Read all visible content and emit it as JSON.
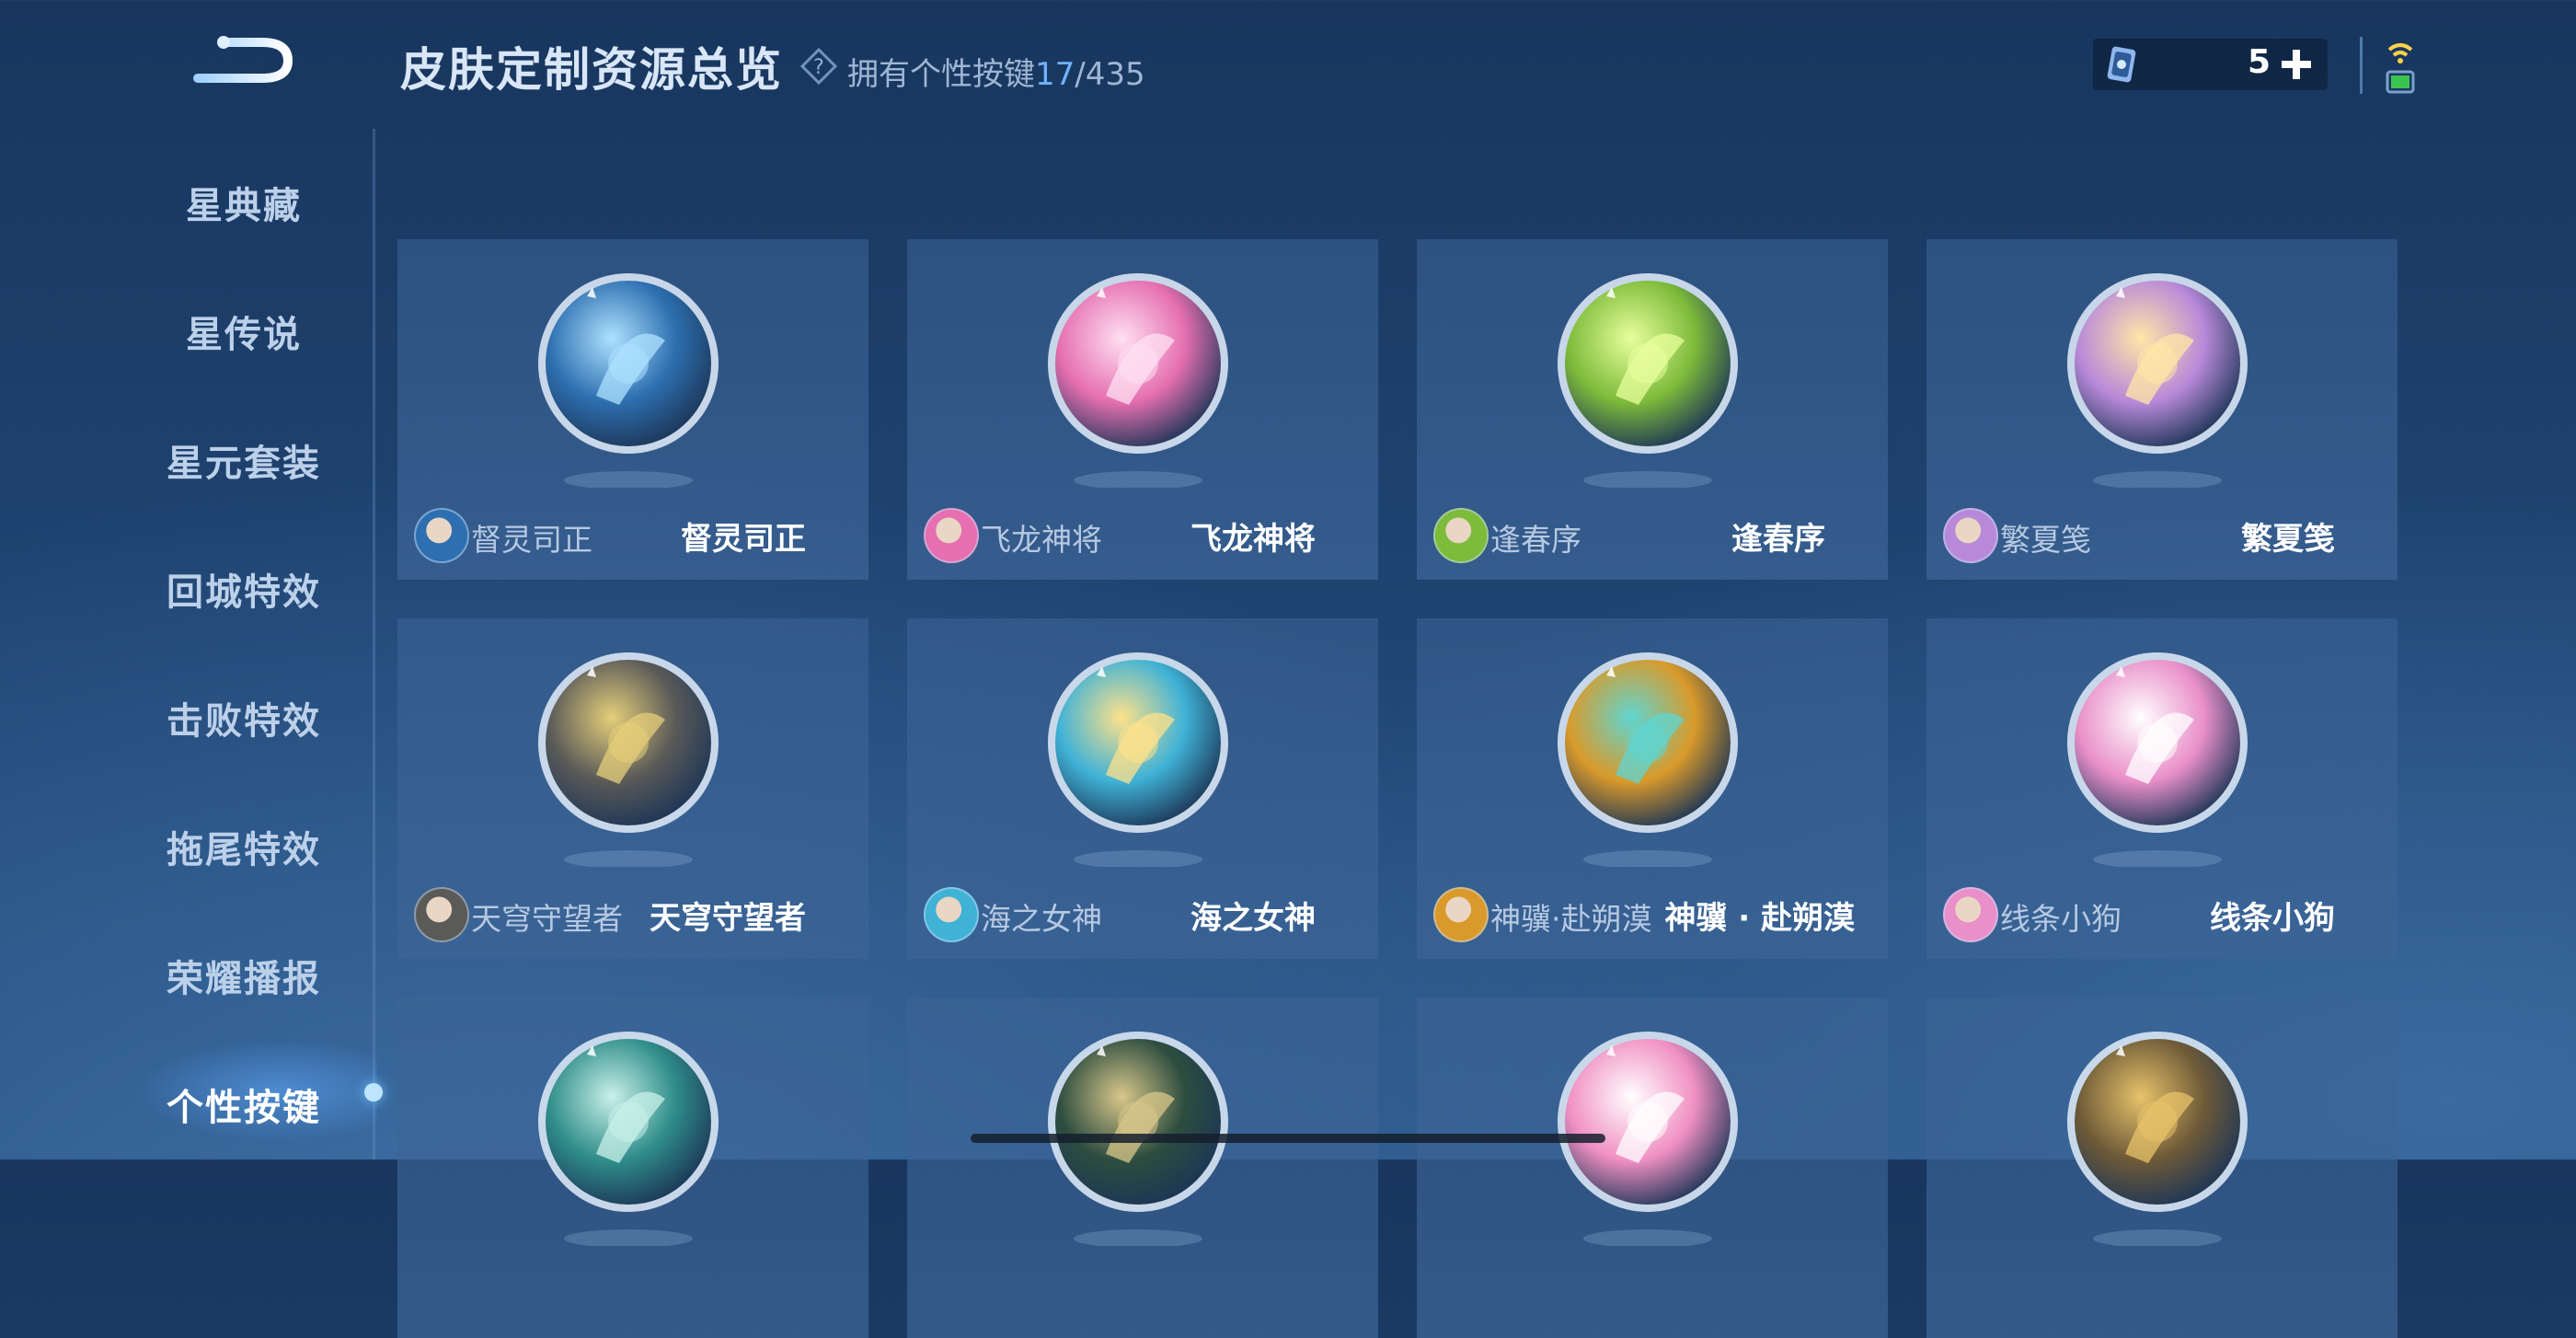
{
  "header": {
    "title": "皮肤定制资源总览",
    "owned_prefix": "拥有个性按键",
    "owned_count": "17",
    "owned_total": "/435"
  },
  "currency": {
    "amount": "5"
  },
  "sidebar": {
    "items": [
      {
        "label": "星典藏"
      },
      {
        "label": "星传说"
      },
      {
        "label": "星元套装"
      },
      {
        "label": "回城特效"
      },
      {
        "label": "击败特效"
      },
      {
        "label": "拖尾特效"
      },
      {
        "label": "荣耀播报"
      },
      {
        "label": "个性按键",
        "active": true
      }
    ]
  },
  "cards": [
    {
      "hero": "督灵司正",
      "skin": "督灵司正",
      "orb_color": "#2d6fb0",
      "orb_accent": "#aee2ff",
      "icon": "dragon-blade-icon"
    },
    {
      "hero": "飞龙神将",
      "skin": "飞龙神将",
      "orb_color": "#e56fb0",
      "orb_accent": "#ffe0f3",
      "icon": "dragon-claw-icon"
    },
    {
      "hero": "逢春序",
      "skin": "逢春序",
      "orb_color": "#7dbb3a",
      "orb_accent": "#e8ff9c",
      "icon": "leaf-icon"
    },
    {
      "hero": "繁夏笺",
      "skin": "繁夏笺",
      "orb_color": "#b889d9",
      "orb_accent": "#ffe7a6",
      "icon": "fairy-icon"
    },
    {
      "hero": "天穹守望者",
      "skin": "天穹守望者",
      "orb_color": "#5a5a58",
      "orb_accent": "#e5cf7a",
      "icon": "crossbow-icon"
    },
    {
      "hero": "海之女神",
      "skin": "海之女神",
      "orb_color": "#3fb2d6",
      "orb_accent": "#ffe28a",
      "icon": "flower-icon"
    },
    {
      "hero": "神骥·赴朔漠",
      "skin": "神骥 · 赴朔漠",
      "orb_color": "#d99a2b",
      "orb_accent": "#5fd6d2",
      "icon": "horse-icon"
    },
    {
      "hero": "线条小狗",
      "skin": "线条小狗",
      "orb_color": "#e98fc9",
      "orb_accent": "#ffffff",
      "icon": "puppy-icon"
    },
    {
      "orb_color": "#2f8d8a",
      "orb_accent": "#c9f1e9",
      "icon": "jade-blade-icon"
    },
    {
      "orb_color": "#2d4d3f",
      "orb_accent": "#d8c78a",
      "icon": "dragon-emblem-icon"
    },
    {
      "orb_color": "#f08fc2",
      "orb_accent": "#ffffff",
      "icon": "melody-icon"
    },
    {
      "orb_color": "#6e5a38",
      "orb_accent": "#e7c36a",
      "icon": "gold-swirl-icon"
    }
  ]
}
